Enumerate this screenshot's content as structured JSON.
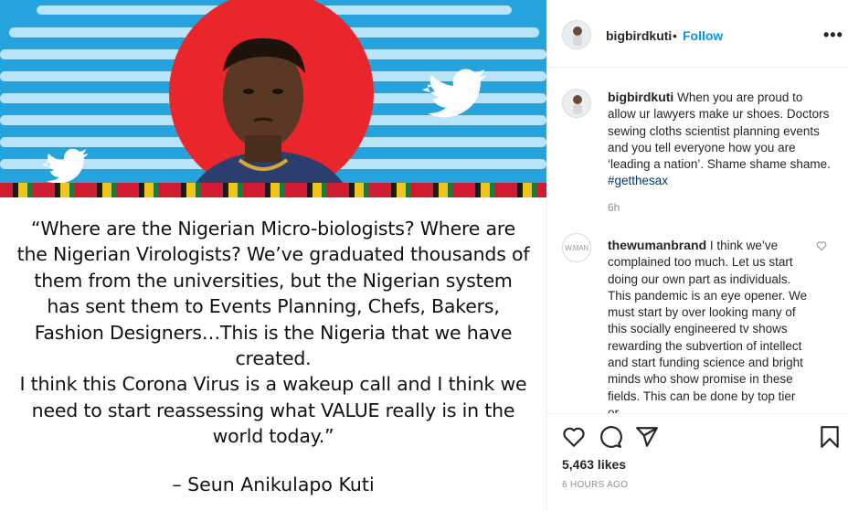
{
  "post": {
    "quote_text": "“Where are the Nigerian Micro-biologists? Where are the Nigerian Virologists?  We’ve graduated thousands of them from the universities, but the Nigerian system has sent them to Events Planning, Chefs, Bakers, Fashion Designers…This is the Nigeria that we have created.\nI think this Corona Virus is a wakeup call and I think we need to start reassessing what VALUE really is in the world today.”",
    "attribution": "– Seun Anikulapo Kuti"
  },
  "header": {
    "username": "bigbirdkuti",
    "separator": "•",
    "follow_label": "Follow",
    "more_label": "•••"
  },
  "caption": {
    "username": "bigbirdkuti",
    "text": "When you are proud to allow ur lawyers make ur shoes. Doctors sewing cloths scientist planning events and you tell everyone how you are ‘leading a nation’. Shame shame shame.",
    "hashtag": "#getthesax",
    "time": "6h"
  },
  "comment": {
    "avatar_text": "W.MAN",
    "username": "thewumanbrand",
    "text": "I think we’ve complained too much. Let us start doing our own part as individuals. This pandemic is an eye opener. We must start by over looking many of this socially engineered tv shows rewarding the subvertion of intellect and start funding science and bright minds who show promise in these fields. This can be done by top tier or"
  },
  "actions": {
    "icons": [
      "heart-icon",
      "comment-icon",
      "share-icon",
      "bookmark-icon"
    ],
    "likes": "5,463 likes",
    "posted_ago": "6 hours ago"
  },
  "colors": {
    "banner_blue": "#25a3dc",
    "sun_red": "#e8262b",
    "link_blue": "#0095f6",
    "hashtag_blue": "#00376b"
  }
}
